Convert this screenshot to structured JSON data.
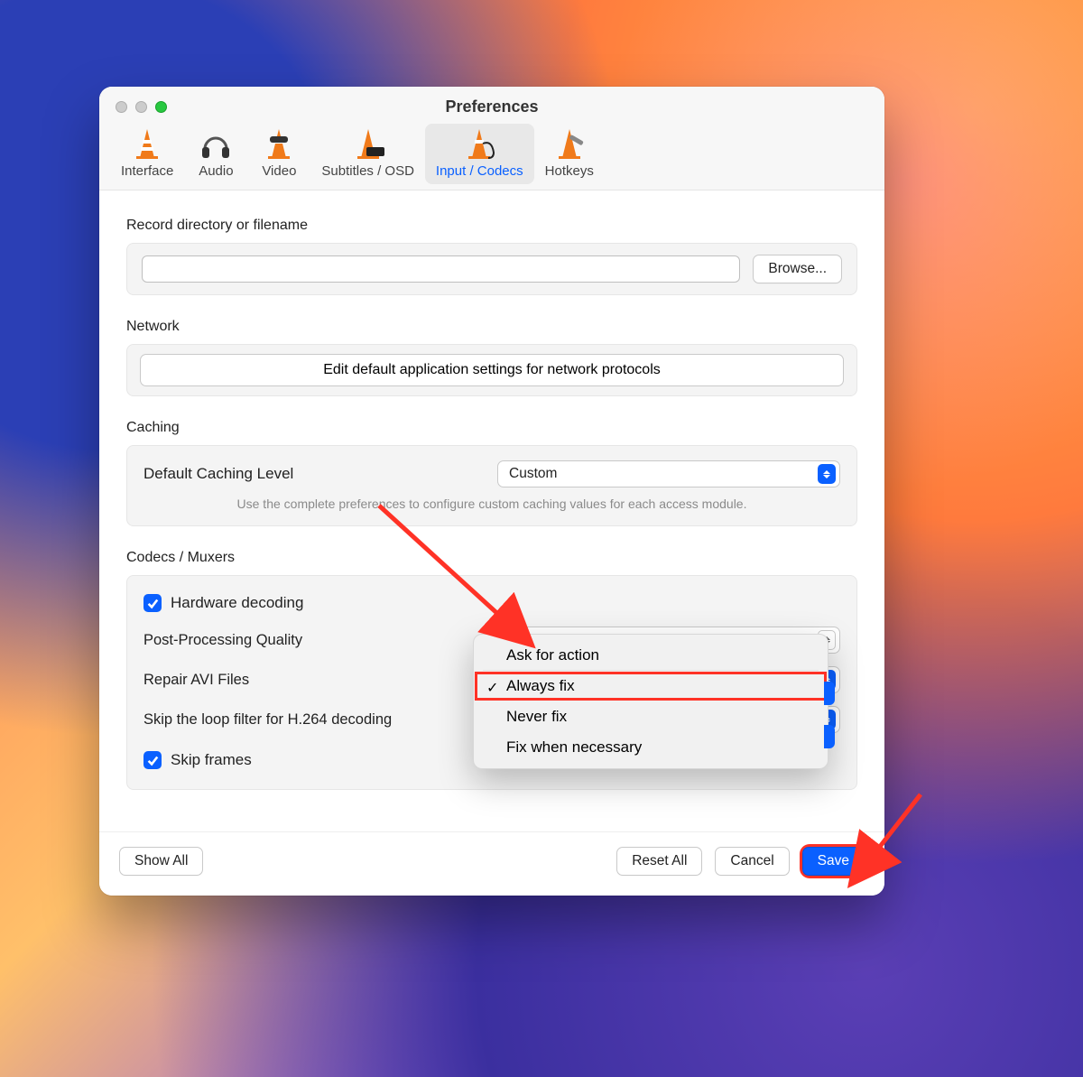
{
  "window": {
    "title": "Preferences"
  },
  "tabs": [
    {
      "label": "Interface"
    },
    {
      "label": "Audio"
    },
    {
      "label": "Video"
    },
    {
      "label": "Subtitles / OSD"
    },
    {
      "label": "Input / Codecs"
    },
    {
      "label": "Hotkeys"
    }
  ],
  "record": {
    "section_label": "Record directory or filename",
    "value": "",
    "browse": "Browse..."
  },
  "network": {
    "section_label": "Network",
    "button": "Edit default application settings for network protocols"
  },
  "caching": {
    "section_label": "Caching",
    "field_label": "Default Caching Level",
    "value": "Custom",
    "hint": "Use the complete preferences to configure custom caching values for each access module."
  },
  "codecs": {
    "section_label": "Codecs / Muxers",
    "hardware_decoding": "Hardware decoding",
    "post_processing": "Post-Processing Quality",
    "repair_avi": "Repair AVI Files",
    "loop_filter": "Skip the loop filter for H.264 decoding",
    "skip_frames": "Skip frames"
  },
  "repair_menu": {
    "options": [
      "Ask for action",
      "Always fix",
      "Never fix",
      "Fix when necessary"
    ],
    "selected_index": 1
  },
  "footer": {
    "show_all": "Show All",
    "reset_all": "Reset All",
    "cancel": "Cancel",
    "save": "Save"
  }
}
